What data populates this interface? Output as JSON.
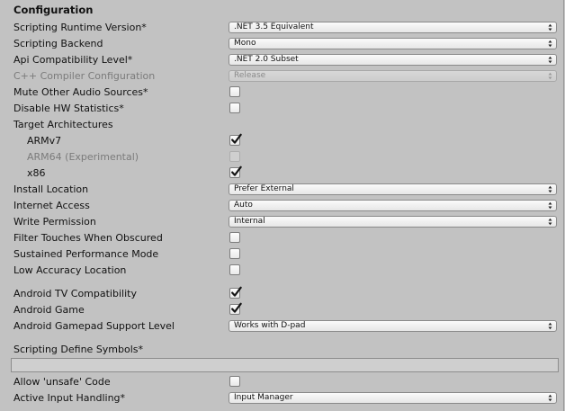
{
  "section": {
    "title": "Configuration"
  },
  "rows": {
    "scripting_runtime": {
      "label": "Scripting Runtime Version*",
      "value": ".NET 3.5 Equivalent"
    },
    "scripting_backend": {
      "label": "Scripting Backend",
      "value": "Mono"
    },
    "api_compat": {
      "label": "Api Compatibility Level*",
      "value": ".NET 2.0 Subset"
    },
    "cpp_compiler": {
      "label": "C++ Compiler Configuration",
      "value": "Release"
    },
    "mute_audio": {
      "label": "Mute Other Audio Sources*",
      "checked": false
    },
    "disable_hw": {
      "label": "Disable HW Statistics*",
      "checked": false
    },
    "target_arch": {
      "label": "Target Architectures"
    },
    "armv7": {
      "label": "ARMv7",
      "checked": true
    },
    "arm64": {
      "label": "ARM64 (Experimental)",
      "checked": false
    },
    "x86": {
      "label": "x86",
      "checked": true
    },
    "install_location": {
      "label": "Install Location",
      "value": "Prefer External"
    },
    "internet_access": {
      "label": "Internet Access",
      "value": "Auto"
    },
    "write_permission": {
      "label": "Write Permission",
      "value": "Internal"
    },
    "filter_touches": {
      "label": "Filter Touches When Obscured",
      "checked": false
    },
    "sustained_perf": {
      "label": "Sustained Performance Mode",
      "checked": false
    },
    "low_accuracy": {
      "label": "Low Accuracy Location",
      "checked": false
    },
    "android_tv": {
      "label": "Android TV Compatibility",
      "checked": true
    },
    "android_game": {
      "label": "Android Game",
      "checked": true
    },
    "gamepad_support": {
      "label": "Android Gamepad Support Level",
      "value": "Works with D-pad"
    },
    "define_symbols": {
      "label": "Scripting Define Symbols*",
      "value": ""
    },
    "allow_unsafe": {
      "label": "Allow 'unsafe' Code",
      "checked": false
    },
    "input_handling": {
      "label": "Active Input Handling*",
      "value": "Input Manager"
    }
  },
  "colors": {
    "panel_bg": "#c2c2c2",
    "disabled_text": "#7b7b7b"
  }
}
